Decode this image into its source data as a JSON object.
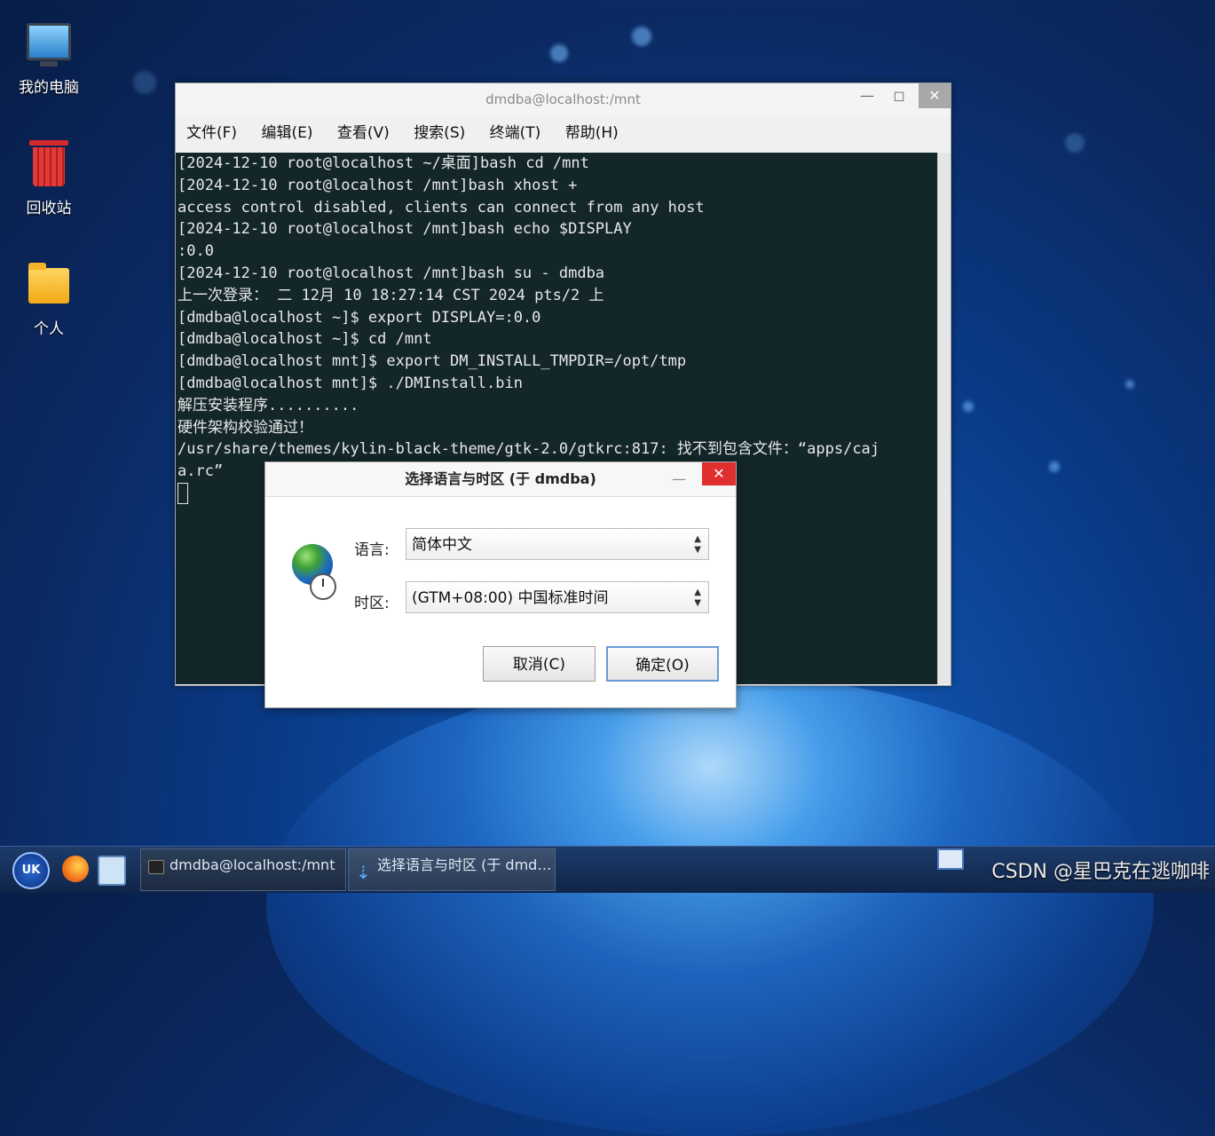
{
  "desktop": {
    "icons": [
      {
        "label": "我的电脑",
        "icon": "computer-icon"
      },
      {
        "label": "回收站",
        "icon": "trash-icon"
      },
      {
        "label": "个人",
        "icon": "home-folder-icon"
      }
    ]
  },
  "terminal": {
    "title": "dmdba@localhost:/mnt",
    "menu": [
      "文件(F)",
      "编辑(E)",
      "查看(V)",
      "搜索(S)",
      "终端(T)",
      "帮助(H)"
    ],
    "lines": [
      "[2024-12-10 root@localhost ~/桌面]bash cd /mnt",
      "[2024-12-10 root@localhost /mnt]bash xhost +",
      "access control disabled, clients can connect from any host",
      "[2024-12-10 root@localhost /mnt]bash echo $DISPLAY",
      ":0.0",
      "[2024-12-10 root@localhost /mnt]bash su - dmdba",
      "上一次登录： 二 12月 10 18:27:14 CST 2024 pts/2 上",
      "[dmdba@localhost ~]$ export DISPLAY=:0.0",
      "[dmdba@localhost ~]$ cd /mnt",
      "[dmdba@localhost mnt]$ export DM_INSTALL_TMPDIR=/opt/tmp",
      "[dmdba@localhost mnt]$ ./DMInstall.bin",
      "解压安装程序..........",
      "硬件架构校验通过！",
      "/usr/share/themes/kylin-black-theme/gtk-2.0/gtkrc:817: 找不到包含文件：“apps/caj",
      "a.rc”"
    ]
  },
  "dialog": {
    "title": "选择语言与时区 (于 dmdba)",
    "language_label": "语言:",
    "language_value": "简体中文",
    "timezone_label": "时区:",
    "timezone_value": "(GTM+08:00) 中国标准时间",
    "cancel_label": "取消(C)",
    "ok_label": "确定(O)"
  },
  "taskbar": {
    "start_label": "UK",
    "tasks": [
      {
        "label": "dmdba@localhost:/mnt"
      },
      {
        "label": "选择语言与时区 (于 dmd…"
      }
    ]
  },
  "watermark": "CSDN @星巴克在逃咖啡"
}
